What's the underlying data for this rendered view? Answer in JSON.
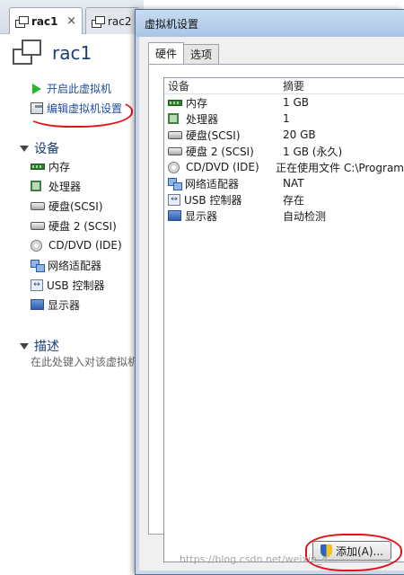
{
  "workstation": {
    "tabs": [
      {
        "label": "rac1",
        "close": "×"
      },
      {
        "label": "rac2"
      }
    ],
    "vm_title": "rac1",
    "actions": {
      "power_on": "开启此虚拟机",
      "edit_settings": "编辑虚拟机设置"
    },
    "devices_section": "设备",
    "devices": [
      {
        "icon": "memory-icon",
        "label": "内存"
      },
      {
        "icon": "cpu-icon",
        "label": "处理器"
      },
      {
        "icon": "harddisk-icon",
        "label": "硬盘(SCSI)"
      },
      {
        "icon": "harddisk-icon",
        "label": "硬盘 2 (SCSI)"
      },
      {
        "icon": "cd-icon",
        "label": "CD/DVD (IDE)"
      },
      {
        "icon": "network-icon",
        "label": "网络适配器"
      },
      {
        "icon": "usb-icon",
        "label": "USB 控制器"
      },
      {
        "icon": "monitor-icon",
        "label": "显示器"
      }
    ],
    "description_section": "描述",
    "description_placeholder": "在此处键入对该虚拟机"
  },
  "dialog": {
    "title": "虚拟机设置",
    "tabs": [
      "硬件",
      "选项"
    ],
    "columns": [
      "设备",
      "摘要"
    ],
    "rows": [
      {
        "icon": "memory-icon",
        "device": "内存",
        "summary": "1 GB"
      },
      {
        "icon": "cpu-icon",
        "device": "处理器",
        "summary": "1"
      },
      {
        "icon": "harddisk-icon",
        "device": "硬盘(SCSI)",
        "summary": "20 GB"
      },
      {
        "icon": "harddisk-icon",
        "device": "硬盘 2 (SCSI)",
        "summary": "1 GB (永久)"
      },
      {
        "icon": "cd-icon",
        "device": "CD/DVD (IDE)",
        "summary": "正在使用文件 C:\\Program"
      },
      {
        "icon": "network-icon",
        "device": "网络适配器",
        "summary": "NAT"
      },
      {
        "icon": "usb-icon",
        "device": "USB 控制器",
        "summary": "存在"
      },
      {
        "icon": "monitor-icon",
        "device": "显示器",
        "summary": "自动检测"
      }
    ],
    "add_button": "添加(A)..."
  },
  "watermark": "https://blog.csdn.net/weixin_4...",
  "colors": {
    "annotation_red": "#e0141b",
    "link_blue": "#1f4fa8",
    "title_blue": "#1a3c78"
  }
}
